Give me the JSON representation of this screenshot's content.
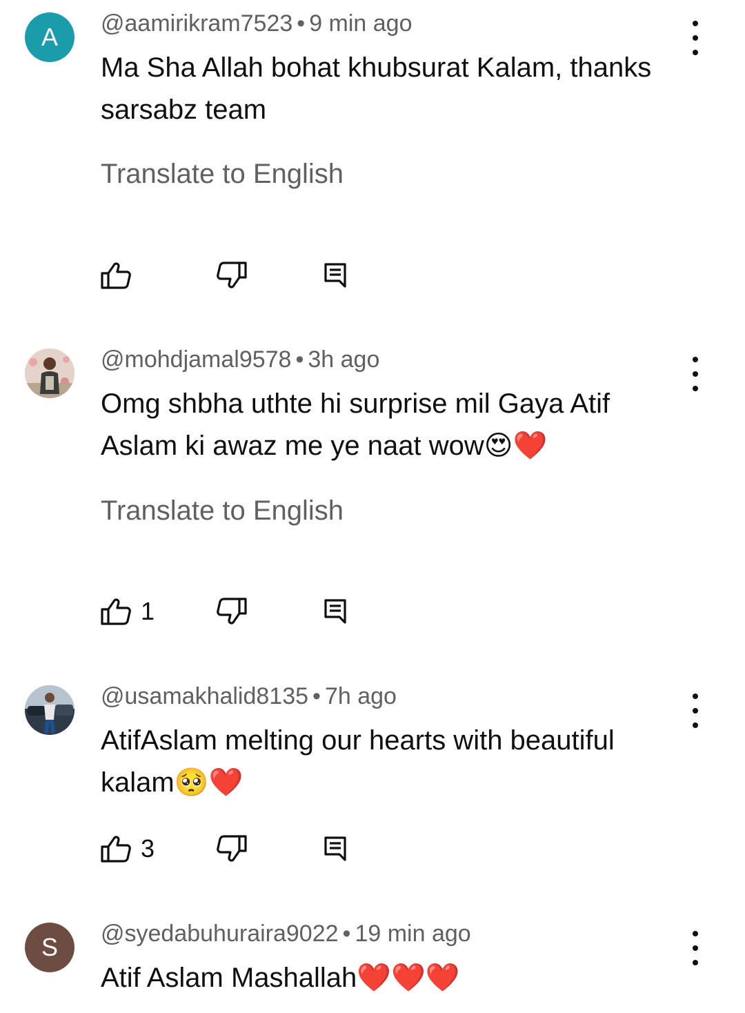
{
  "comments": [
    {
      "avatar_letter": "A",
      "avatar_color": "#1b9cab",
      "username": "@aamirikram7523",
      "time": "9 min ago",
      "text": "Ma Sha Allah bohat khubsurat Kalam, thanks sarsabz team",
      "translate": "Translate to English",
      "likes": ""
    },
    {
      "avatar_letter": "",
      "username": "@mohdjamal9578",
      "time": "3h ago",
      "text": "Omg shbha uthte hi surprise mil Gaya Atif Aslam ki awaz me ye naat wow",
      "emojis": "😍❤️",
      "translate": "Translate to English",
      "likes": "1"
    },
    {
      "avatar_letter": "",
      "username": "@usamakhalid8135",
      "time": "7h ago",
      "text": "AtifAslam melting our hearts with beautiful kalam",
      "emojis": "🥺❤️",
      "likes": "3"
    },
    {
      "avatar_letter": "S",
      "avatar_color": "#6d4c41",
      "username": "@syedabuhuraira9022",
      "time": "19 min ago",
      "text": "Atif Aslam Mashallah",
      "emojis": "❤️❤️❤️"
    }
  ],
  "separator": "•",
  "icons": {
    "like": "thumbs-up-icon",
    "dislike": "thumbs-down-icon",
    "reply": "reply-icon",
    "more": "more-vertical-icon"
  }
}
